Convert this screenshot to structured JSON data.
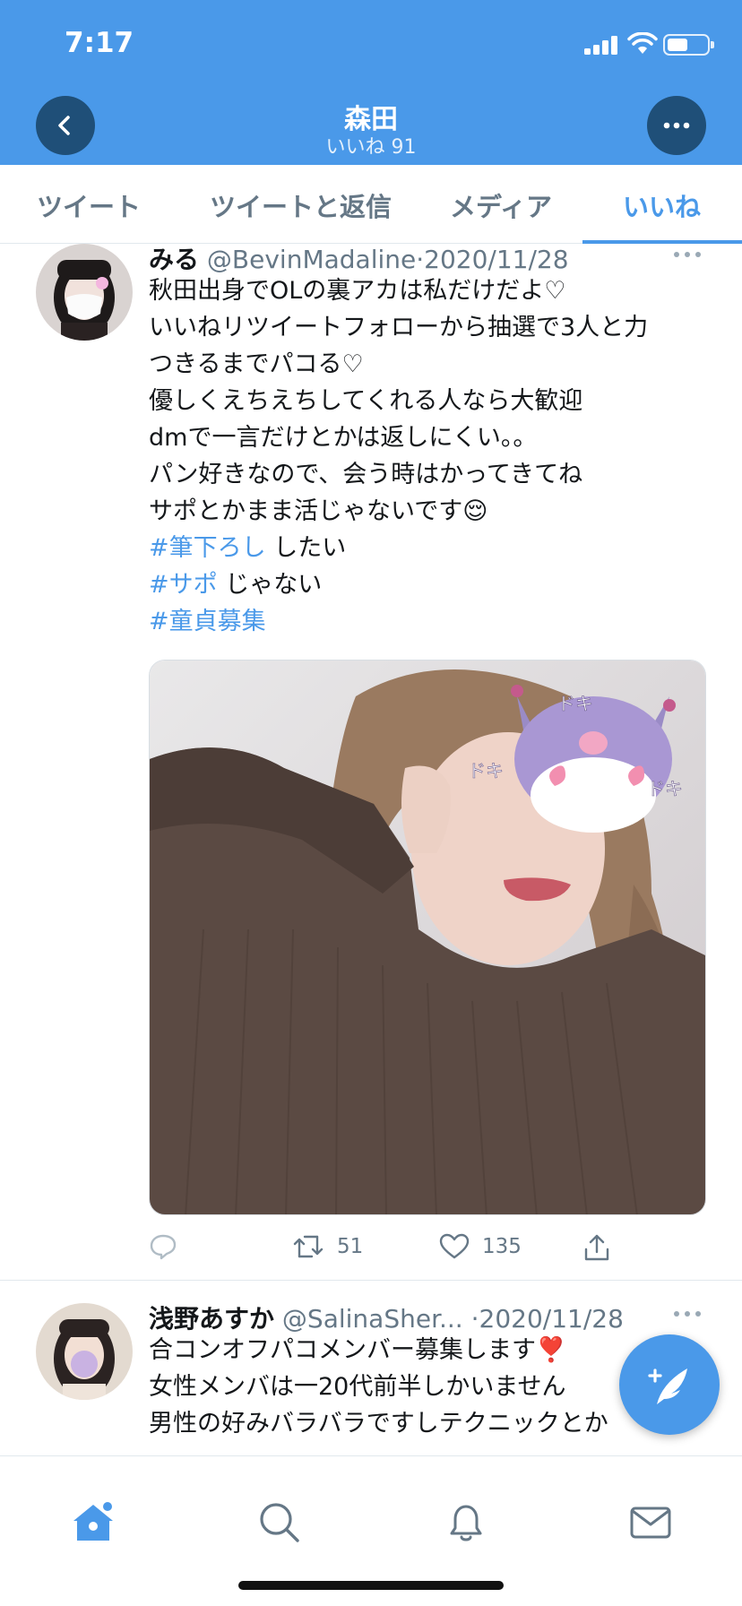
{
  "status_bar": {
    "time": "7:17"
  },
  "header": {
    "title": "森田",
    "subtitle": "いいね 91"
  },
  "tabs": [
    {
      "label": "ツイート",
      "active": false
    },
    {
      "label": "ツイートと返信",
      "active": false
    },
    {
      "label": "メディア",
      "active": false
    },
    {
      "label": "いいね",
      "active": true
    }
  ],
  "tweets": [
    {
      "name": "みる",
      "handle": "@BevinMadaline",
      "date": "2020/11/28",
      "lines": [
        "秋田出身でOLの裏アカは私だけだよ♡",
        "いいねリツイートフォローから抽選で3人と力",
        "つきるまでパコる♡",
        "優しくえちえちしてくれる人なら大歓迎",
        "dmで一言だけとかは返しにくい。。",
        "パン好きなので、会う時はかってきてね",
        "サポとかまま活じゃないです😌"
      ],
      "tag_lines": [
        {
          "tag": "#筆下ろし",
          "rest": " したい"
        },
        {
          "tag": "#サポ",
          "rest": " じゃない"
        },
        {
          "tag": "#童貞募集",
          "rest": ""
        }
      ],
      "photo_stickers": [
        "ドキ",
        "ドキ",
        "ドキ"
      ],
      "retweets": "51",
      "likes": "135"
    },
    {
      "name": "浅野あすか",
      "handle": "@SalinaSher...",
      "date": "2020/11/28",
      "lines": [
        "合コンオフパコメンバー募集します❣️",
        "女性メンバは一20代前半しかいません",
        "男性の好みバラバラですしテクニックとか"
      ]
    }
  ],
  "icons": {
    "back": "chevron-left-icon",
    "more": "more-icon",
    "reply": "reply-icon",
    "retweet": "retweet-icon",
    "like": "heart-icon",
    "share": "share-icon",
    "compose": "compose-icon",
    "home": "home-icon",
    "search": "search-icon",
    "notifications": "bell-icon",
    "messages": "mail-icon"
  },
  "colors": {
    "accent": "#4a99e9",
    "header_button": "#1f4f78",
    "muted": "#657786"
  }
}
